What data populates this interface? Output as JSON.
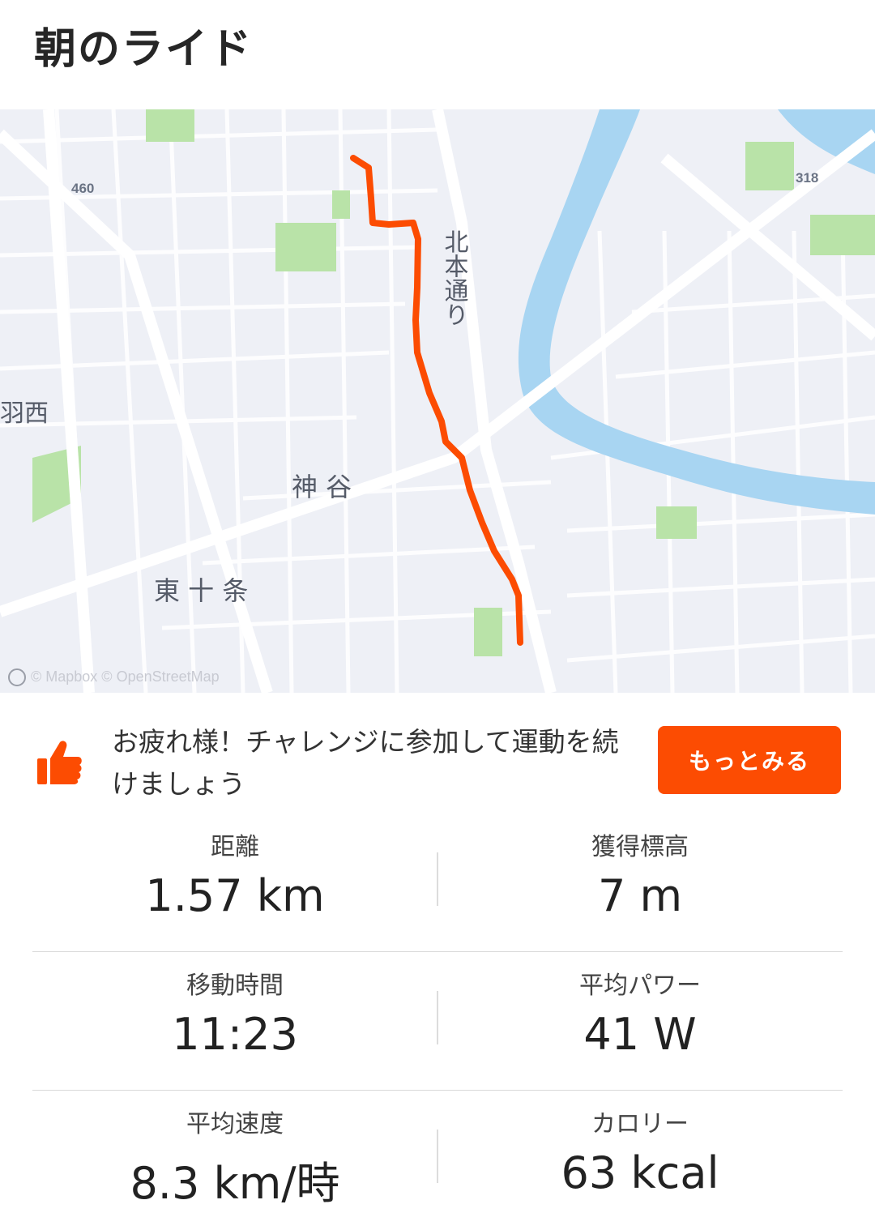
{
  "activity": {
    "title": "朝のライド"
  },
  "map": {
    "labels": {
      "road_north": "北本通り",
      "kamiya": "神 谷",
      "higashi_jujo": "東 十 条",
      "nishi": "羽西",
      "route_460": "460",
      "route_318": "318"
    },
    "attribution": "© Mapbox © OpenStreetMap",
    "route_color": "#fc4c02",
    "water_color": "#a8d5f2",
    "park_color": "#b9e3a8"
  },
  "challenge": {
    "icon": "thumbs-up-icon",
    "message": "お疲れ様！チャレンジに参加して運動を続けましょう",
    "button_label": "もっとみる",
    "accent": "#fc4c02"
  },
  "stats": [
    {
      "label": "距離",
      "value": "1.57 km"
    },
    {
      "label": "獲得標高",
      "value": "7 m"
    },
    {
      "label": "移動時間",
      "value": "11:23"
    },
    {
      "label": "平均パワー",
      "value": "41 W"
    },
    {
      "label": "平均速度",
      "value": "8.3 km/時"
    },
    {
      "label": "カロリー",
      "value": "63 kcal"
    }
  ]
}
